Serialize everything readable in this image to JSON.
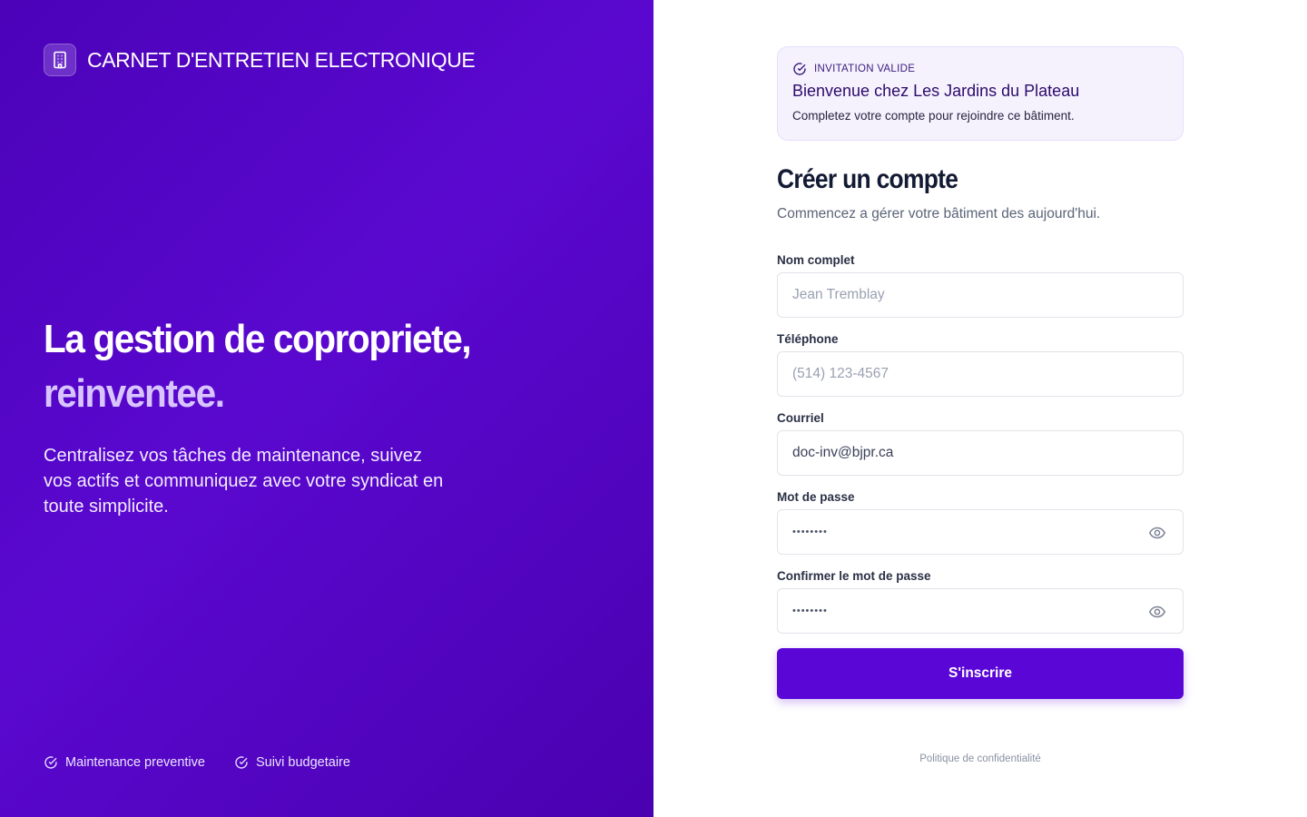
{
  "brand": {
    "name": "CARNET D'ENTRETIEN ELECTRONIQUE",
    "logo_icon": "building-icon"
  },
  "hero": {
    "title_line1": "La gestion de copropriete,",
    "title_line2": "reinventee.",
    "subtitle": "Centralisez vos tâches de maintenance, suivez vos actifs et communiquez avec votre syndicat en toute simplicite."
  },
  "features": [
    {
      "label": "Maintenance preventive",
      "icon": "check-circle-icon"
    },
    {
      "label": "Suivi budgetaire",
      "icon": "check-circle-icon"
    }
  ],
  "invitation": {
    "tag": "INVITATION VALIDE",
    "title": "Bienvenue chez Les Jardins du Plateau",
    "description": "Completez votre compte pour rejoindre ce bâtiment."
  },
  "form": {
    "title": "Créer un compte",
    "subtitle": "Commencez a gérer votre bâtiment des aujourd'hui.",
    "fields": {
      "name": {
        "label": "Nom complet",
        "placeholder": "Jean Tremblay",
        "value": ""
      },
      "phone": {
        "label": "Téléphone",
        "placeholder": "(514) 123-4567",
        "value": ""
      },
      "email": {
        "label": "Courriel",
        "placeholder": "",
        "value": "doc-inv@bjpr.ca"
      },
      "password": {
        "label": "Mot de passe",
        "value": "••••••••"
      },
      "confirm": {
        "label": "Confirmer le mot de passe",
        "value": "••••••••"
      }
    },
    "submit_label": "S'inscrire"
  },
  "footer": {
    "privacy_link": "Politique de confidentialité"
  },
  "colors": {
    "primary": "#5a06d6",
    "left_panel": "#4b02b8",
    "accent_text": "#d8c4ff"
  }
}
